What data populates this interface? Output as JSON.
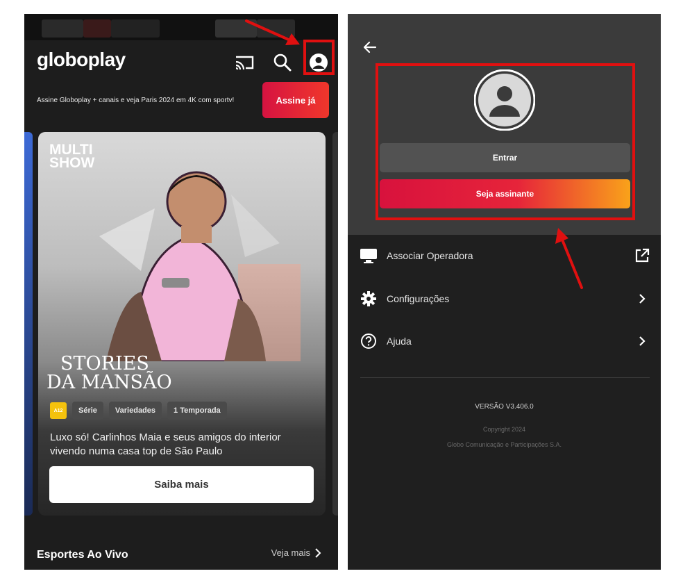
{
  "left_screen": {
    "app_logo": "globoplay",
    "promo": {
      "text": "Assine Globoplay + canais e veja Paris 2024 em 4K com sportv!",
      "button": "Assine já"
    },
    "featured": {
      "channel_logo_line1": "MULTI",
      "channel_logo_line2": "SHOW",
      "title_line1": "STORIES",
      "title_line2": "DA MANSÃO",
      "age_rating": "A12",
      "tags": [
        "Série",
        "Variedades",
        "1 Temporada"
      ],
      "description": "Luxo só! Carlinhos Maia e seus amigos do interior vivendo numa casa top de São Paulo",
      "cta": "Saiba mais"
    },
    "section": {
      "title": "Esportes Ao Vivo",
      "link": "Veja mais"
    },
    "icons": [
      "cast-icon",
      "search-icon",
      "profile-icon"
    ]
  },
  "right_screen": {
    "buttons": {
      "login": "Entrar",
      "subscribe": "Seja assinante"
    },
    "menu": [
      {
        "label": "Associar Operadora",
        "icon": "monitor-icon",
        "tail": "external-link-icon"
      },
      {
        "label": "Configurações",
        "icon": "gear-icon",
        "tail": "chevron-right-icon"
      },
      {
        "label": "Ajuda",
        "icon": "help-icon",
        "tail": "chevron-right-icon"
      }
    ],
    "version": "VERSÃO V3.406.0",
    "copyright": "Copyright 2024",
    "company": "Globo Comunicação e Participações S.A."
  },
  "colors": {
    "accent_red": "#e01010",
    "subscribe_gradient_start": "#d8123d",
    "subscribe_gradient_end": "#f9a21a",
    "age_badge": "#f4c20d"
  }
}
